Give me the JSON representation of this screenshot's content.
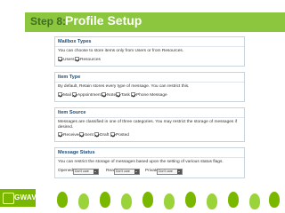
{
  "header": {
    "step_label": "Step 8:",
    "title": "Profile Setup"
  },
  "mailbox_type": {
    "title": "Mailbox Types",
    "description": "You can choose to store items only from Users or from Resources.",
    "options": [
      "Users",
      "Resources"
    ]
  },
  "item_type": {
    "title": "Item Type",
    "description": "By default, Retain stores every type of message. You can restrict this.",
    "options": [
      "Mail",
      "Appointment",
      "Note",
      "Task",
      "Phone Message"
    ]
  },
  "item_source": {
    "title": "Item Source",
    "description": "Messages are classified in one of three categories. You may restrict the storage of messages if desired.",
    "options": [
      "Received",
      "Sent",
      "Draft",
      "Posted"
    ]
  },
  "message_status": {
    "title": "Message Status",
    "description": "You can restrict the storage of messages based upon the setting of various status flags.",
    "opened_label": "Opened",
    "read_label": "Read",
    "private_label": "Private",
    "select_value": "Don't care"
  },
  "footer": {
    "logo_text": "GWAVA"
  }
}
